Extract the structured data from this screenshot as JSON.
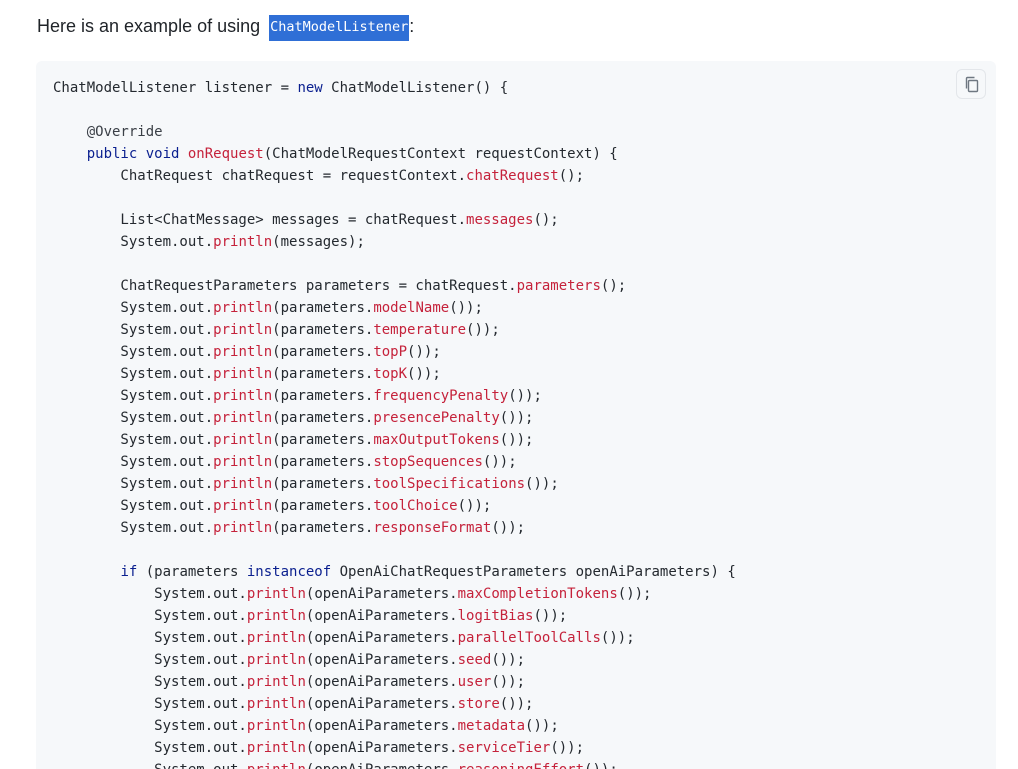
{
  "intro": {
    "text": "Here is an example of using ",
    "inline_code": "ChatModelListener",
    "suffix": ":"
  },
  "copy_button": {
    "icon": "copy-icon"
  },
  "colors": {
    "keyword": "#0a1f8f",
    "method": "#c5223b",
    "code_bg": "#f6f8fa",
    "highlight_bg": "#2f6fd6"
  },
  "code": {
    "lines": [
      [
        [
          "t",
          "ChatModelListener listener = "
        ],
        [
          "k",
          "new"
        ],
        [
          "t",
          " ChatModelListener() {"
        ]
      ],
      [],
      [
        [
          "t",
          "    "
        ],
        [
          "a",
          "@Override"
        ]
      ],
      [
        [
          "t",
          "    "
        ],
        [
          "k",
          "public void"
        ],
        [
          "t",
          " "
        ],
        [
          "f",
          "onRequest"
        ],
        [
          "t",
          "(ChatModelRequestContext requestContext) {"
        ]
      ],
      [
        [
          "t",
          "        ChatRequest chatRequest = requestContext."
        ],
        [
          "f",
          "chatRequest"
        ],
        [
          "t",
          "();"
        ]
      ],
      [],
      [
        [
          "t",
          "        List<ChatMessage> messages = chatRequest."
        ],
        [
          "f",
          "messages"
        ],
        [
          "t",
          "();"
        ]
      ],
      [
        [
          "t",
          "        System.out."
        ],
        [
          "f",
          "println"
        ],
        [
          "t",
          "(messages);"
        ]
      ],
      [],
      [
        [
          "t",
          "        ChatRequestParameters parameters = chatRequest."
        ],
        [
          "f",
          "parameters"
        ],
        [
          "t",
          "();"
        ]
      ],
      [
        [
          "t",
          "        System.out."
        ],
        [
          "f",
          "println"
        ],
        [
          "t",
          "(parameters."
        ],
        [
          "f",
          "modelName"
        ],
        [
          "t",
          "());"
        ]
      ],
      [
        [
          "t",
          "        System.out."
        ],
        [
          "f",
          "println"
        ],
        [
          "t",
          "(parameters."
        ],
        [
          "f",
          "temperature"
        ],
        [
          "t",
          "());"
        ]
      ],
      [
        [
          "t",
          "        System.out."
        ],
        [
          "f",
          "println"
        ],
        [
          "t",
          "(parameters."
        ],
        [
          "f",
          "topP"
        ],
        [
          "t",
          "());"
        ]
      ],
      [
        [
          "t",
          "        System.out."
        ],
        [
          "f",
          "println"
        ],
        [
          "t",
          "(parameters."
        ],
        [
          "f",
          "topK"
        ],
        [
          "t",
          "());"
        ]
      ],
      [
        [
          "t",
          "        System.out."
        ],
        [
          "f",
          "println"
        ],
        [
          "t",
          "(parameters."
        ],
        [
          "f",
          "frequencyPenalty"
        ],
        [
          "t",
          "());"
        ]
      ],
      [
        [
          "t",
          "        System.out."
        ],
        [
          "f",
          "println"
        ],
        [
          "t",
          "(parameters."
        ],
        [
          "f",
          "presencePenalty"
        ],
        [
          "t",
          "());"
        ]
      ],
      [
        [
          "t",
          "        System.out."
        ],
        [
          "f",
          "println"
        ],
        [
          "t",
          "(parameters."
        ],
        [
          "f",
          "maxOutputTokens"
        ],
        [
          "t",
          "());"
        ]
      ],
      [
        [
          "t",
          "        System.out."
        ],
        [
          "f",
          "println"
        ],
        [
          "t",
          "(parameters."
        ],
        [
          "f",
          "stopSequences"
        ],
        [
          "t",
          "());"
        ]
      ],
      [
        [
          "t",
          "        System.out."
        ],
        [
          "f",
          "println"
        ],
        [
          "t",
          "(parameters."
        ],
        [
          "f",
          "toolSpecifications"
        ],
        [
          "t",
          "());"
        ]
      ],
      [
        [
          "t",
          "        System.out."
        ],
        [
          "f",
          "println"
        ],
        [
          "t",
          "(parameters."
        ],
        [
          "f",
          "toolChoice"
        ],
        [
          "t",
          "());"
        ]
      ],
      [
        [
          "t",
          "        System.out."
        ],
        [
          "f",
          "println"
        ],
        [
          "t",
          "(parameters."
        ],
        [
          "f",
          "responseFormat"
        ],
        [
          "t",
          "());"
        ]
      ],
      [],
      [
        [
          "t",
          "        "
        ],
        [
          "k",
          "if"
        ],
        [
          "t",
          " (parameters "
        ],
        [
          "k",
          "instanceof"
        ],
        [
          "t",
          " OpenAiChatRequestParameters openAiParameters) {"
        ]
      ],
      [
        [
          "t",
          "            System.out."
        ],
        [
          "f",
          "println"
        ],
        [
          "t",
          "(openAiParameters."
        ],
        [
          "f",
          "maxCompletionTokens"
        ],
        [
          "t",
          "());"
        ]
      ],
      [
        [
          "t",
          "            System.out."
        ],
        [
          "f",
          "println"
        ],
        [
          "t",
          "(openAiParameters."
        ],
        [
          "f",
          "logitBias"
        ],
        [
          "t",
          "());"
        ]
      ],
      [
        [
          "t",
          "            System.out."
        ],
        [
          "f",
          "println"
        ],
        [
          "t",
          "(openAiParameters."
        ],
        [
          "f",
          "parallelToolCalls"
        ],
        [
          "t",
          "());"
        ]
      ],
      [
        [
          "t",
          "            System.out."
        ],
        [
          "f",
          "println"
        ],
        [
          "t",
          "(openAiParameters."
        ],
        [
          "f",
          "seed"
        ],
        [
          "t",
          "());"
        ]
      ],
      [
        [
          "t",
          "            System.out."
        ],
        [
          "f",
          "println"
        ],
        [
          "t",
          "(openAiParameters."
        ],
        [
          "f",
          "user"
        ],
        [
          "t",
          "());"
        ]
      ],
      [
        [
          "t",
          "            System.out."
        ],
        [
          "f",
          "println"
        ],
        [
          "t",
          "(openAiParameters."
        ],
        [
          "f",
          "store"
        ],
        [
          "t",
          "());"
        ]
      ],
      [
        [
          "t",
          "            System.out."
        ],
        [
          "f",
          "println"
        ],
        [
          "t",
          "(openAiParameters."
        ],
        [
          "f",
          "metadata"
        ],
        [
          "t",
          "());"
        ]
      ],
      [
        [
          "t",
          "            System.out."
        ],
        [
          "f",
          "println"
        ],
        [
          "t",
          "(openAiParameters."
        ],
        [
          "f",
          "serviceTier"
        ],
        [
          "t",
          "());"
        ]
      ],
      [
        [
          "t",
          "            System.out."
        ],
        [
          "f",
          "println"
        ],
        [
          "t",
          "(openAiParameters."
        ],
        [
          "f",
          "reasoningEffort"
        ],
        [
          "t",
          "());"
        ]
      ]
    ]
  }
}
